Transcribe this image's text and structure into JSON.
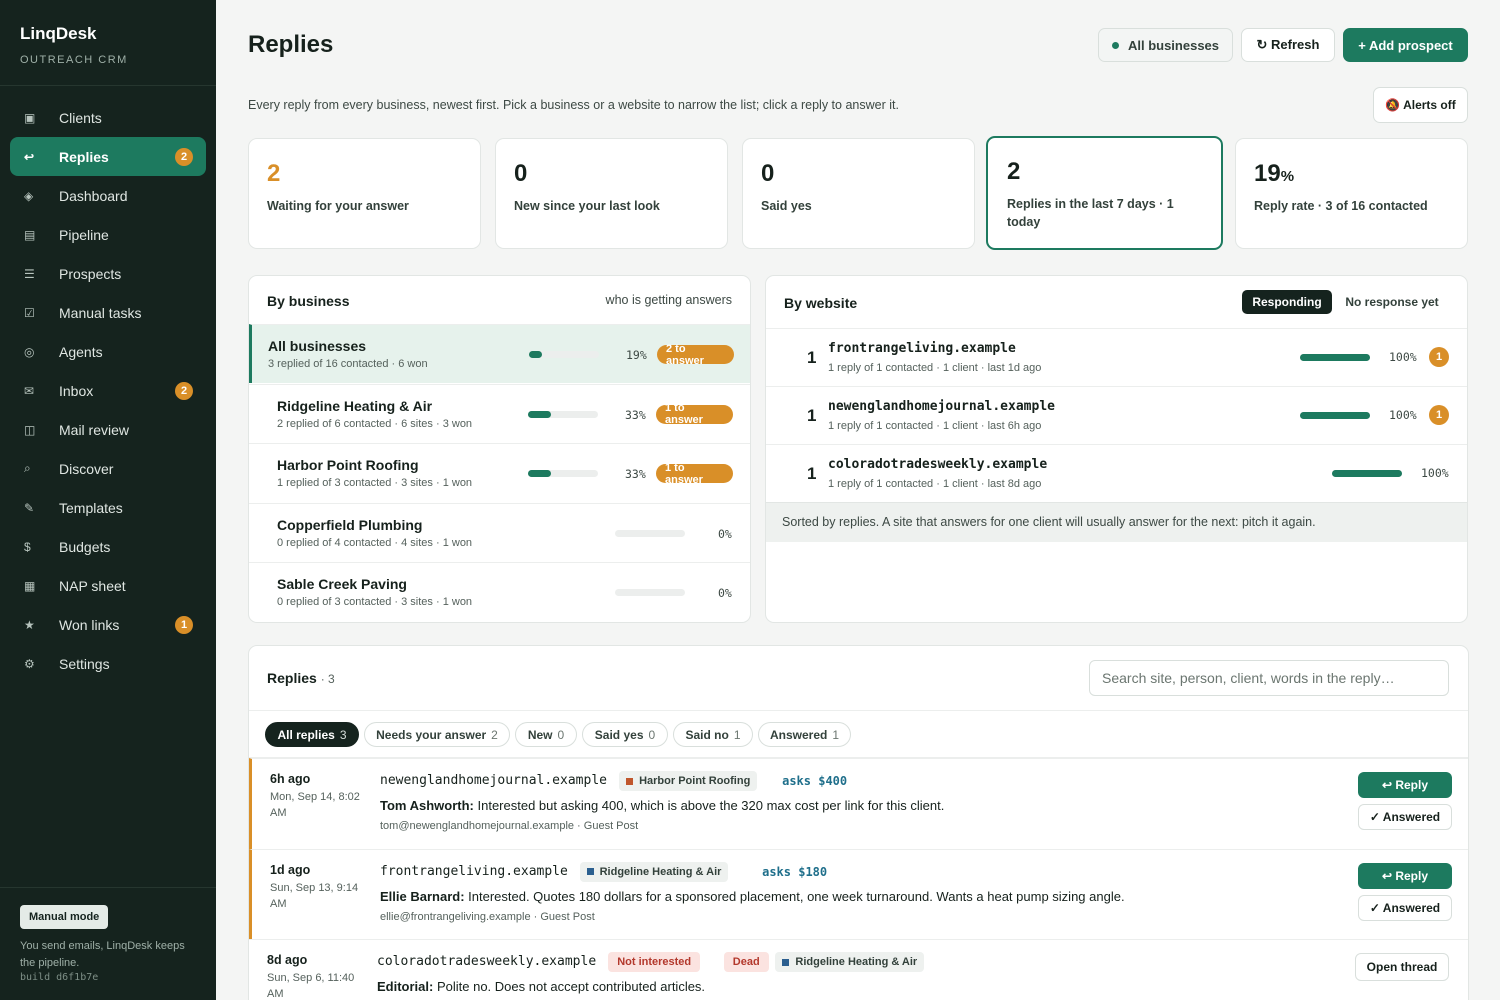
{
  "brand": {
    "name": "LinqDesk",
    "sub": "OUTREACH CRM"
  },
  "nav": [
    {
      "icon": "▣",
      "label": "Clients",
      "badge": ""
    },
    {
      "icon": "↩",
      "label": "Replies",
      "badge": "2"
    },
    {
      "icon": "◈",
      "label": "Dashboard",
      "badge": ""
    },
    {
      "icon": "▤",
      "label": "Pipeline",
      "badge": ""
    },
    {
      "icon": "☰",
      "label": "Prospects",
      "badge": ""
    },
    {
      "icon": "☑",
      "label": "Manual tasks",
      "badge": ""
    },
    {
      "icon": "◎",
      "label": "Agents",
      "badge": ""
    },
    {
      "icon": "✉",
      "label": "Inbox",
      "badge": "2"
    },
    {
      "icon": "◫",
      "label": "Mail review",
      "badge": ""
    },
    {
      "icon": "⌕",
      "label": "Discover",
      "badge": ""
    },
    {
      "icon": "✎",
      "label": "Templates",
      "badge": ""
    },
    {
      "icon": "$",
      "label": "Budgets",
      "badge": ""
    },
    {
      "icon": "▦",
      "label": "NAP sheet",
      "badge": ""
    },
    {
      "icon": "★",
      "label": "Won links",
      "badge": "1"
    },
    {
      "icon": "⚙",
      "label": "Settings",
      "badge": ""
    }
  ],
  "footer": {
    "mode": "Manual mode",
    "text": "You send emails, LinqDesk keeps the pipeline.",
    "build": "build d6f1b7e"
  },
  "header": {
    "title": "Replies",
    "filter": "All businesses",
    "refresh": "↻ Refresh",
    "add": "+ Add prospect"
  },
  "intro": "Every reply from every business, newest first. Pick a business or a website to narrow the list; click a reply to answer it.",
  "alerts": "🔕 Alerts off",
  "stats": [
    {
      "value": "2",
      "label": "Waiting for your answer"
    },
    {
      "value": "0",
      "label": "New since your last look"
    },
    {
      "value": "0",
      "label": "Said yes"
    },
    {
      "value": "2",
      "label": "Replies in the last 7 days · 1 today"
    },
    {
      "value": "19",
      "unit": "%",
      "label": "Reply rate · 3 of 16 contacted"
    }
  ],
  "by_business": {
    "title": "By business",
    "aside": "who is getting answers",
    "rows": [
      {
        "name": "All businesses",
        "sub": "3 replied of 16 contacted · 6 won",
        "rate": 0.19,
        "pct": "19%",
        "pill": "2 to answer"
      },
      {
        "name": "Ridgeline Heating & Air",
        "sub": "2 replied of 6 contacted · 6 sites · 3 won",
        "rate": 0.33,
        "pct": "33%",
        "pill": "1 to answer"
      },
      {
        "name": "Harbor Point Roofing",
        "sub": "1 replied of 3 contacted · 3 sites · 1 won",
        "rate": 0.33,
        "pct": "33%",
        "pill": "1 to answer"
      },
      {
        "name": "Copperfield Plumbing",
        "sub": "0 replied of 4 contacted · 4 sites · 1 won",
        "rate": 0,
        "pct": "0%",
        "pill": ""
      },
      {
        "name": "Sable Creek Paving",
        "sub": "0 replied of 3 contacted · 3 sites · 1 won",
        "rate": 0,
        "pct": "0%",
        "pill": ""
      }
    ]
  },
  "by_website": {
    "title": "By website",
    "tabs": [
      "Responding",
      "No response yet"
    ],
    "rows": [
      {
        "count": "1",
        "site": "frontrangeliving.example",
        "sub": "1 reply of 1 contacted · 1 client · last 1d ago",
        "rate": 1,
        "pct": "100%",
        "badge": "1"
      },
      {
        "count": "1",
        "site": "newenglandhomejournal.example",
        "sub": "1 reply of 1 contacted · 1 client · last 6h ago",
        "rate": 1,
        "pct": "100%",
        "badge": "1"
      },
      {
        "count": "1",
        "site": "coloradotradesweekly.example",
        "sub": "1 reply of 1 contacted · 1 client · last 8d ago",
        "rate": 1,
        "pct": "100%",
        "badge": ""
      }
    ],
    "note": "Sorted by replies. A site that answers for one client will usually answer for the next: pitch it again."
  },
  "replies": {
    "title": "Replies",
    "count": "· 3",
    "search_placeholder": "Search site, person, client, words in the reply…",
    "filters": [
      {
        "label": "All replies",
        "count": "3"
      },
      {
        "label": "Needs your answer",
        "count": "2"
      },
      {
        "label": "New",
        "count": "0"
      },
      {
        "label": "Said yes",
        "count": "0"
      },
      {
        "label": "Said no",
        "count": "1"
      },
      {
        "label": "Answered",
        "count": "1"
      }
    ],
    "items": [
      {
        "when": "6h ago",
        "date": "Mon, Sep 14, 8:02 AM",
        "site": "newenglandhomejournal.example",
        "client": "Harbor Point Roofing",
        "client_color": "#c0562c",
        "asks": "asks $400",
        "person": "Tom Ashworth:",
        "text": " Interested but asking 400, which is above the 320 max cost per link for this client.",
        "meta": "tom@newenglandhomejournal.example · Guest Post",
        "primary": "↩ Reply",
        "secondary": "✓ Answered"
      },
      {
        "when": "1d ago",
        "date": "Sun, Sep 13, 9:14 AM",
        "site": "frontrangeliving.example",
        "client": "Ridgeline Heating & Air",
        "client_color": "#2b5f8f",
        "asks": "asks $180",
        "person": "Ellie Barnard:",
        "text": " Interested. Quotes 180 dollars for a sponsored placement, one week turnaround. Wants a heat pump sizing angle.",
        "meta": "ellie@frontrangeliving.example · Guest Post",
        "primary": "↩ Reply",
        "secondary": "✓ Answered"
      },
      {
        "when": "8d ago",
        "date": "Sun, Sep 6, 11:40 AM",
        "site": "coloradotradesweekly.example",
        "tags": [
          "Not interested",
          "Dead"
        ],
        "client": "Ridgeline Heating & Air",
        "client_color": "#2b5f8f",
        "person": "Editorial:",
        "text": " Polite no. Does not accept contributed articles.",
        "open": "Open thread"
      }
    ]
  }
}
